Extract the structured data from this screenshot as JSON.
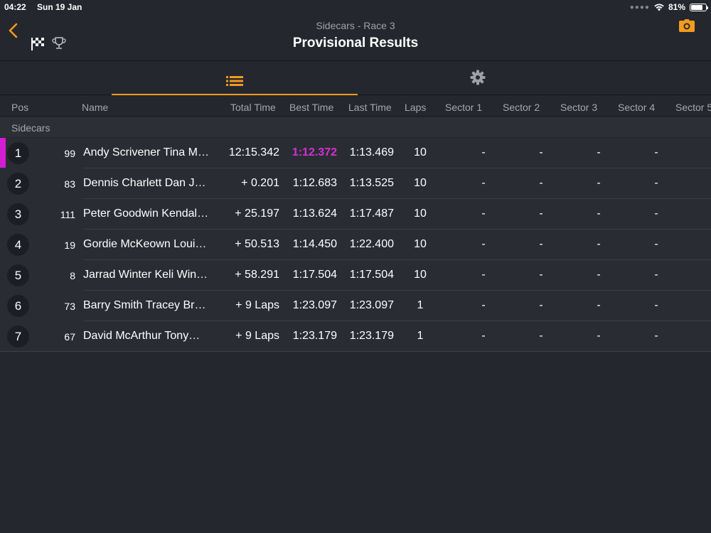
{
  "status": {
    "time": "04:22",
    "date": "Sun 19 Jan",
    "battery": "81%",
    "battery_level": 0.81
  },
  "header": {
    "subtitle": "Sidecars - Race 3",
    "title": "Provisional Results"
  },
  "colors": {
    "accent": "#f29b1d",
    "fastest": "#d430d4",
    "background": "#25272e"
  },
  "columns": {
    "pos": "Pos",
    "name": "Name",
    "total_time": "Total Time",
    "best_time": "Best Time",
    "last_time": "Last Time",
    "laps": "Laps",
    "sector1": "Sector 1",
    "sector2": "Sector 2",
    "sector3": "Sector 3",
    "sector4": "Sector 4",
    "sector5": "Sector 5"
  },
  "group": "Sidecars",
  "results": [
    {
      "pos": "1",
      "num": "99",
      "name": "Andy Scrivener Tina M…",
      "total": "12:15.342",
      "best": "1:12.372",
      "last": "1:13.469",
      "laps": "10",
      "s1": "-",
      "s2": "-",
      "s3": "-",
      "s4": "-",
      "fastest": true
    },
    {
      "pos": "2",
      "num": "83",
      "name": "Dennis Charlett Dan J…",
      "total": "+ 0.201",
      "best": "1:12.683",
      "last": "1:13.525",
      "laps": "10",
      "s1": "-",
      "s2": "-",
      "s3": "-",
      "s4": "-"
    },
    {
      "pos": "3",
      "num": "111",
      "name": "Peter Goodwin Kendal…",
      "total": "+ 25.197",
      "best": "1:13.624",
      "last": "1:17.487",
      "laps": "10",
      "s1": "-",
      "s2": "-",
      "s3": "-",
      "s4": "-"
    },
    {
      "pos": "4",
      "num": "19",
      "name": "Gordie McKeown Loui…",
      "total": "+ 50.513",
      "best": "1:14.450",
      "last": "1:22.400",
      "laps": "10",
      "s1": "-",
      "s2": "-",
      "s3": "-",
      "s4": "-"
    },
    {
      "pos": "5",
      "num": "8",
      "name": "Jarrad Winter Keli Win…",
      "total": "+ 58.291",
      "best": "1:17.504",
      "last": "1:17.504",
      "laps": "10",
      "s1": "-",
      "s2": "-",
      "s3": "-",
      "s4": "-"
    },
    {
      "pos": "6",
      "num": "73",
      "name": "Barry Smith Tracey Br…",
      "total": "+ 9 Laps",
      "best": "1:23.097",
      "last": "1:23.097",
      "laps": "1",
      "s1": "-",
      "s2": "-",
      "s3": "-",
      "s4": "-"
    },
    {
      "pos": "7",
      "num": "67",
      "name": "David McArthur Tony…",
      "total": "+ 9 Laps",
      "best": "1:23.179",
      "last": "1:23.179",
      "laps": "1",
      "s1": "-",
      "s2": "-",
      "s3": "-",
      "s4": "-"
    }
  ]
}
